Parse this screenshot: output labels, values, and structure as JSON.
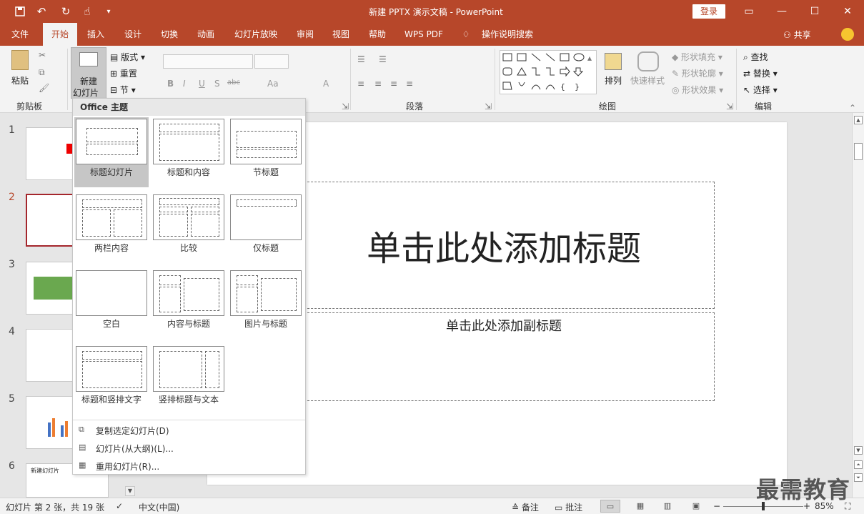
{
  "titlebar": {
    "title": "新建 PPTX 演示文稿 - PowerPoint",
    "login": "登录",
    "qa_icons": [
      "save-icon",
      "undo-icon",
      "redo-icon",
      "touch-mode-icon",
      "customize-icon"
    ]
  },
  "tabs": [
    {
      "label": "文件"
    },
    {
      "label": "开始"
    },
    {
      "label": "插入"
    },
    {
      "label": "设计"
    },
    {
      "label": "切换"
    },
    {
      "label": "动画"
    },
    {
      "label": "幻灯片放映"
    },
    {
      "label": "审阅"
    },
    {
      "label": "视图"
    },
    {
      "label": "帮助"
    },
    {
      "label": "WPS PDF"
    },
    {
      "label": "操作说明搜索"
    }
  ],
  "share": "共享",
  "ribbon": {
    "clipboard": {
      "paste": "粘贴",
      "label": "剪贴板"
    },
    "slides": {
      "new_slide_1": "新建",
      "new_slide_2": "幻灯片",
      "layout": "版式",
      "reset": "重置",
      "section": "节"
    },
    "paragraph": {
      "label": "段落"
    },
    "drawing": {
      "arrange": "排列",
      "quick_styles": "快速样式",
      "fill": "形状填充",
      "outline": "形状轮廓",
      "effects": "形状效果",
      "label": "绘图"
    },
    "editing": {
      "find": "查找",
      "replace": "替换",
      "select": "选择",
      "label": "编辑"
    },
    "font": {
      "bold": "B",
      "italic": "I",
      "underline": "U",
      "shadow": "S",
      "strike": "abc",
      "aa": "Aa",
      "a": "A"
    }
  },
  "slides": {
    "numbers": [
      "1",
      "2",
      "3",
      "4",
      "5",
      "6"
    ],
    "active_index": 2,
    "thumb6_text": "新建幻灯片"
  },
  "canvas": {
    "title_placeholder": "单击此处添加标题",
    "subtitle_placeholder": "单击此处添加副标题"
  },
  "dropdown": {
    "header": "Office 主题",
    "layouts": [
      {
        "label": "标题幻灯片"
      },
      {
        "label": "标题和内容"
      },
      {
        "label": "节标题"
      },
      {
        "label": "两栏内容"
      },
      {
        "label": "比较"
      },
      {
        "label": "仅标题"
      },
      {
        "label": "空白"
      },
      {
        "label": "内容与标题"
      },
      {
        "label": "图片与标题"
      },
      {
        "label": "标题和竖排文字"
      },
      {
        "label": "竖排标题与文本"
      }
    ],
    "actions": [
      {
        "label": "复制选定幻灯片(D)"
      },
      {
        "label": "幻灯片(从大纲)(L)..."
      },
      {
        "label": "重用幻灯片(R)..."
      }
    ]
  },
  "status": {
    "slide_info": "幻灯片 第 2 张，共 19 张",
    "language": "中文(中国)",
    "notes": "备注",
    "comments": "批注",
    "zoom_percent": "85%",
    "zoom_level": 0.5
  },
  "watermark": "最需教育",
  "colors": {
    "brand": "#b7472a",
    "active_slide": "#a4262c"
  }
}
